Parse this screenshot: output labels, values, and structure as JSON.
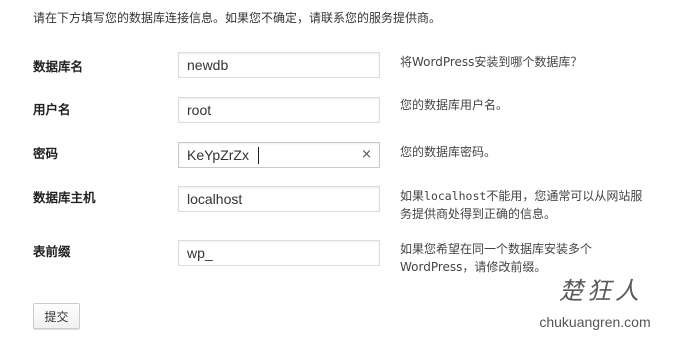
{
  "intro": "请在下方填写您的数据库连接信息。如果您不确定，请联系您的服务提供商。",
  "fields": [
    {
      "label": "数据库名",
      "value": "newdb",
      "description": "将WordPress安装到哪个数据库？"
    },
    {
      "label": "用户名",
      "value": "root",
      "description": "您的数据库用户名。"
    },
    {
      "label": "密码",
      "value": "KeYpZrZx",
      "description": "您的数据库密码。",
      "clear_icon": "×"
    },
    {
      "label": "数据库主机",
      "value": "localhost",
      "description_line1_prefix": "如果",
      "description_line1_code": "localhost",
      "description_line1_suffix": "不能用，您通常可以从网站服",
      "description_line2": "务提供商处得到正确的信息。"
    },
    {
      "label": "表前缀",
      "value": "wp_",
      "description_line1": "如果您希望在同一个数据库安装多个",
      "description_line2": "WordPress，请修改前缀。"
    }
  ],
  "submit_label": "提交",
  "watermark": {
    "name": "楚狂人",
    "url": "chukuangren.com"
  }
}
